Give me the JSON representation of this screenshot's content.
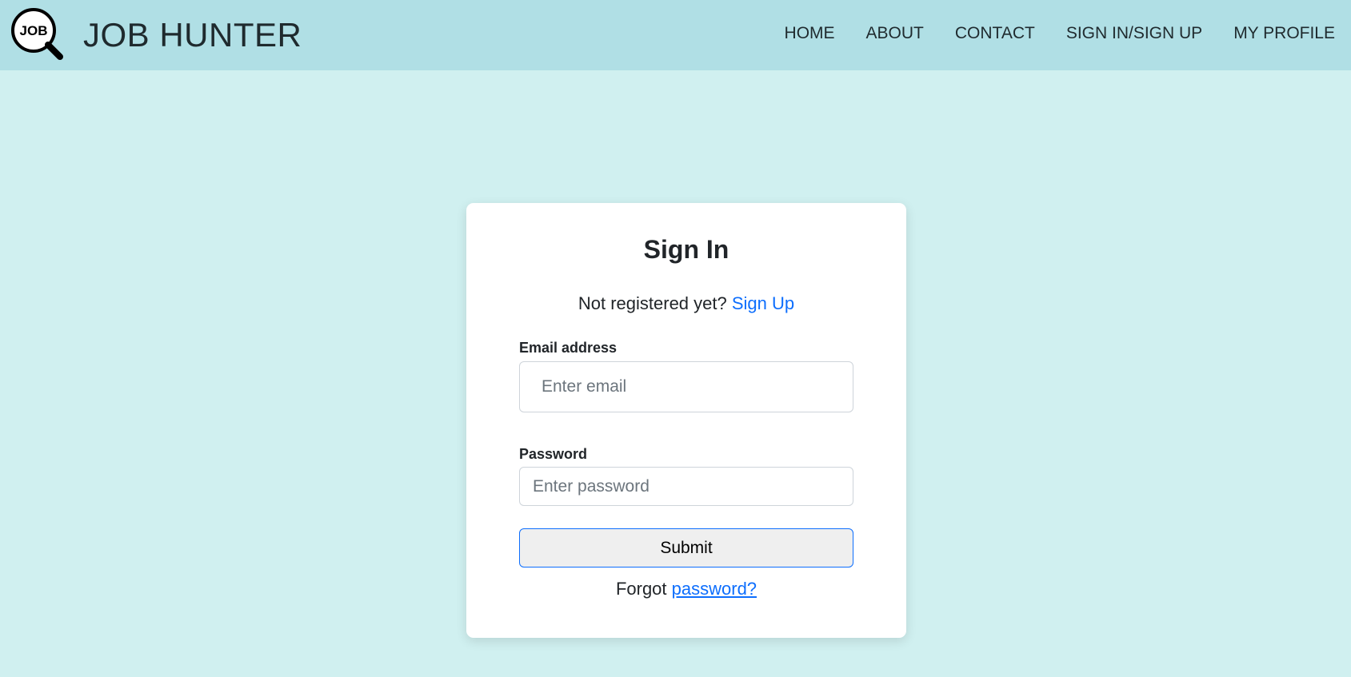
{
  "header": {
    "logo_text": "JOB",
    "brand": "JOB HUNTER",
    "nav": [
      {
        "label": "HOME"
      },
      {
        "label": "ABOUT"
      },
      {
        "label": "CONTACT"
      },
      {
        "label": "SIGN IN/SIGN UP"
      },
      {
        "label": "MY PROFILE"
      }
    ]
  },
  "signin": {
    "title": "Sign In",
    "not_registered_text": "Not registered yet?",
    "signup_link": "Sign Up",
    "email_label": "Email address",
    "email_placeholder": "Enter email",
    "email_value": "",
    "password_label": "Password",
    "password_placeholder": "Enter password",
    "password_value": "",
    "submit_label": "Submit",
    "forgot_text": "Forgot",
    "forgot_link": "password?"
  },
  "colors": {
    "page_background": "#d0f0f0",
    "header_background": "#b0dfe5",
    "link": "#0d6efd",
    "card_background": "#ffffff"
  },
  "icons": {
    "logo": "magnifying-glass-icon"
  }
}
